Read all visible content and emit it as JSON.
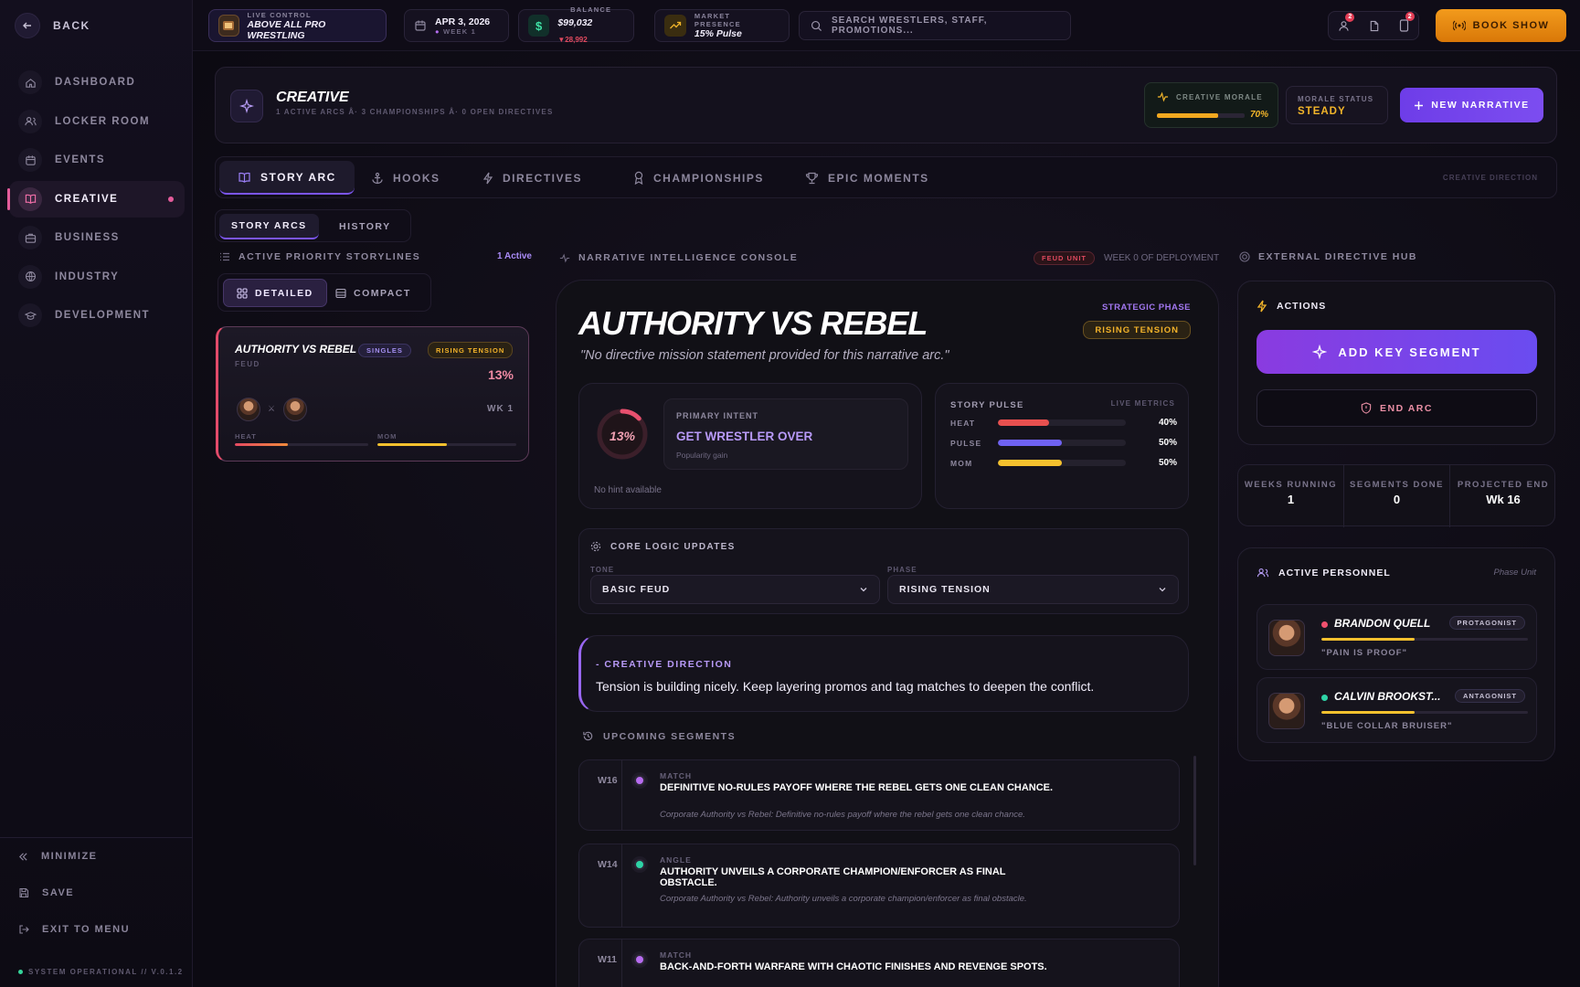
{
  "sidebar": {
    "back": "BACK",
    "items": [
      {
        "label": "DASHBOARD",
        "icon": "home-icon"
      },
      {
        "label": "LOCKER ROOM",
        "icon": "users-icon"
      },
      {
        "label": "EVENTS",
        "icon": "calendar-icon"
      },
      {
        "label": "CREATIVE",
        "icon": "book-icon",
        "active": true
      },
      {
        "label": "BUSINESS",
        "icon": "briefcase-icon"
      },
      {
        "label": "INDUSTRY",
        "icon": "globe-icon"
      },
      {
        "label": "DEVELOPMENT",
        "icon": "graduation-cap-icon"
      }
    ],
    "minimize": "MINIMIZE",
    "save": "SAVE",
    "exit": "EXIT TO MENU",
    "status": "SYSTEM OPERATIONAL // V.0.1.2"
  },
  "topbar": {
    "live_label": "LIVE CONTROL",
    "promotion": "ABOVE ALL PRO WRESTLING",
    "date": "APR 3, 2026",
    "week": "WEEK 1",
    "balance_label": "BALANCE",
    "balance": "$99,032",
    "balance_delta": "▼28,992",
    "market_label": "MARKET PRESENCE",
    "market": "15% Pulse",
    "search_placeholder": "SEARCH WRESTLERS, STAFF, PROMOTIONS...",
    "badge_users": "2",
    "badge_phone": "2",
    "book_show": "BOOK SHOW"
  },
  "header": {
    "title": "CREATIVE",
    "subtitle": "1 ACTIVE ARCS Â· 3 CHAMPIONSHIPS Â· 0 OPEN DIRECTIVES",
    "morale_label": "CREATIVE MORALE",
    "morale_value": "70%",
    "morale_fraction": 0.7,
    "status_label": "MORALE STATUS",
    "status_value": "STEADY",
    "new_narrative": "NEW NARRATIVE"
  },
  "tabs": [
    {
      "label": "STORY ARC",
      "icon": "book-icon",
      "active": true
    },
    {
      "label": "HOOKS",
      "icon": "anchor-icon"
    },
    {
      "label": "DIRECTIVES",
      "icon": "bolt-icon"
    },
    {
      "label": "CHAMPIONSHIPS",
      "icon": "medal-icon"
    },
    {
      "label": "EPIC MOMENTS",
      "icon": "trophy-icon"
    }
  ],
  "tab_hint": "CREATIVE DIRECTION",
  "subtabs": [
    "STORY ARCS",
    "HISTORY"
  ],
  "left": {
    "section": "ACTIVE PRIORITY STORYLINES",
    "active_count": "1 Active",
    "view_detailed": "DETAILED",
    "view_compact": "COMPACT",
    "arc": {
      "title": "AUTHORITY VS REBEL",
      "type_tag": "SINGLES",
      "phase_tag": "RISING TENSION",
      "kind": "FEUD",
      "percent": "13%",
      "week": "WK 1",
      "heat_label": "HEAT",
      "mom_label": "MOM",
      "heat": 0.4,
      "mom": 0.5
    }
  },
  "console": {
    "label": "NARRATIVE INTELLIGENCE CONSOLE",
    "unit_tag": "FEUD UNIT",
    "deployment": "WEEK 0 OF DEPLOYMENT",
    "title": "AUTHORITY VS REBEL",
    "quote": "\"No directive mission statement provided for this narrative arc.\"",
    "phase_label": "STRATEGIC PHASE",
    "phase_value": "RISING TENSION",
    "ring_value": "13%",
    "ring_fraction": 0.13,
    "intent_label": "PRIMARY INTENT",
    "intent_value": "GET WRESTLER OVER",
    "intent_sub": "Popularity gain",
    "hint": "No hint available",
    "pulse_label": "STORY PULSE",
    "pulse_live": "LIVE METRICS",
    "metrics": [
      {
        "label": "HEAT",
        "value": "40%",
        "fraction": 0.4,
        "color": "#e8504f"
      },
      {
        "label": "PULSE",
        "value": "50%",
        "fraction": 0.5,
        "color": "#6f62f2"
      },
      {
        "label": "MOM",
        "value": "50%",
        "fraction": 0.5,
        "color": "#f5c12e"
      }
    ],
    "core_label": "CORE LOGIC UPDATES",
    "tone_label": "TONE",
    "tone_value": "BASIC FEUD",
    "phase_sel_label": "PHASE",
    "phase_sel_value": "RISING TENSION",
    "direction_label": "- CREATIVE DIRECTION",
    "direction_text": "Tension is building nicely. Keep layering promos and tag matches to deepen the conflict.",
    "upcoming_label": "UPCOMING SEGMENTS",
    "segments": [
      {
        "week": "W16",
        "type": "MATCH",
        "title": "DEFINITIVE NO-RULES PAYOFF WHERE THE REBEL GETS ONE CLEAN CHANCE.",
        "desc": "Corporate Authority vs Rebel: Definitive no-rules payoff where the rebel gets one clean chance.",
        "color": "#b76cf0"
      },
      {
        "week": "W14",
        "type": "ANGLE",
        "title": "AUTHORITY UNVEILS A CORPORATE CHAMPION/ENFORCER AS FINAL OBSTACLE.",
        "desc": "Corporate Authority vs Rebel: Authority unveils a corporate champion/enforcer as final obstacle.",
        "color": "#2ed3a6"
      },
      {
        "week": "W11",
        "type": "MATCH",
        "title": "BACK-AND-FORTH WARFARE WITH CHAOTIC FINISHES AND REVENGE SPOTS.",
        "desc": "",
        "color": "#b76cf0"
      }
    ]
  },
  "right": {
    "hub_label": "EXTERNAL DIRECTIVE HUB",
    "actions_label": "ACTIONS",
    "add_segment": "ADD KEY SEGMENT",
    "end_arc": "END ARC",
    "stats": [
      {
        "k": "WEEKS RUNNING",
        "v": "1"
      },
      {
        "k": "SEGMENTS DONE",
        "v": "0"
      },
      {
        "k": "PROJECTED END",
        "v": "Wk 16"
      }
    ],
    "personnel_label": "ACTIVE PERSONNEL",
    "personnel_unit": "Phase Unit",
    "personnel": [
      {
        "name": "BRANDON QUELL",
        "role": "PROTAGONIST",
        "quote": "\"PAIN IS PROOF\"",
        "dot": "#f0506e",
        "bar": 0.45
      },
      {
        "name": "CALVIN BROOKST...",
        "role": "ANTAGONIST",
        "quote": "\"BLUE COLLAR BRUISER\"",
        "dot": "#2ed3a6",
        "bar": 0.45
      }
    ]
  }
}
